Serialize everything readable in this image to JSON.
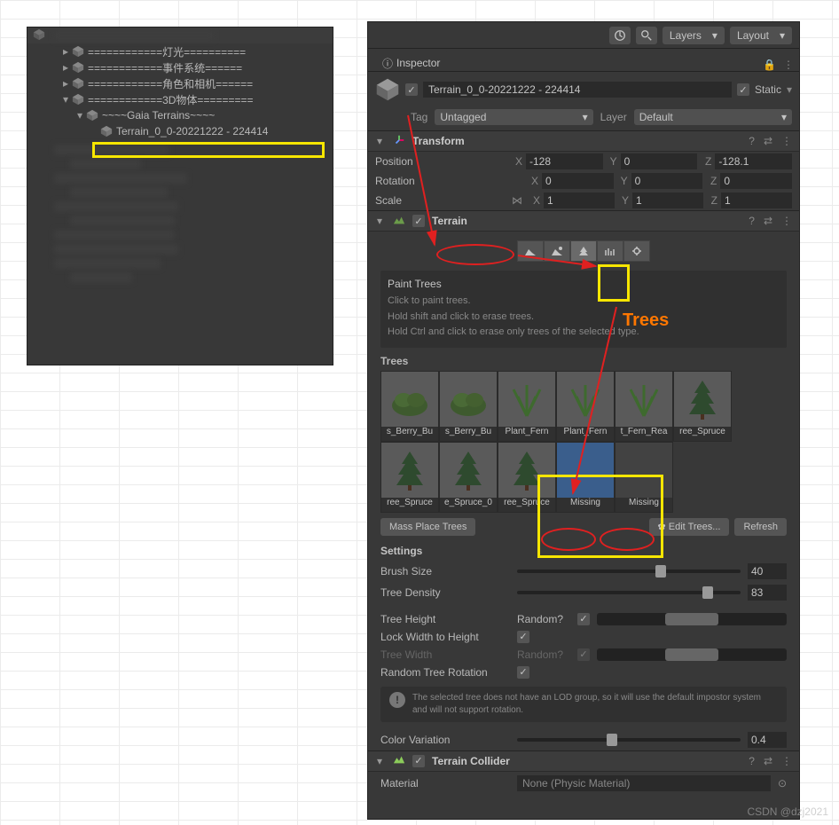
{
  "hierarchy": {
    "items": [
      {
        "indent": 0,
        "fold": "▸",
        "label": "============灯光=========="
      },
      {
        "indent": 0,
        "fold": "▸",
        "label": "============事件系统======"
      },
      {
        "indent": 0,
        "fold": "▸",
        "label": "============角色和相机======"
      },
      {
        "indent": 0,
        "fold": "▾",
        "label": "============3D物体========="
      },
      {
        "indent": 1,
        "fold": "▾",
        "label": "~~~~Gaia Terrains~~~~"
      },
      {
        "indent": 2,
        "fold": "",
        "label": "Terrain_0_0-20221222 - 224414",
        "selected": true
      }
    ]
  },
  "topbar": {
    "layers": "Layers",
    "layout": "Layout"
  },
  "inspector": {
    "tab_label": "Inspector",
    "object_name": "Terrain_0_0-20221222 - 224414",
    "static_label": "Static",
    "tag_label": "Tag",
    "tag_value": "Untagged",
    "layer_label": "Layer",
    "layer_value": "Default"
  },
  "transform": {
    "title": "Transform",
    "rows": {
      "position": {
        "label": "Position",
        "x": "-128",
        "y": "0",
        "z": "-128.1"
      },
      "rotation": {
        "label": "Rotation",
        "x": "0",
        "y": "0",
        "z": "0"
      },
      "scale": {
        "label": "Scale",
        "x": "1",
        "y": "1",
        "z": "1"
      }
    },
    "axes": {
      "x": "X",
      "y": "Y",
      "z": "Z"
    }
  },
  "terrain": {
    "title": "Terrain",
    "paint_title": "Paint Trees",
    "paint_hint": "Click to paint trees.",
    "hint_shift": "Hold shift and click to erase trees.",
    "hint_ctrl": "Hold Ctrl and click to erase only trees of the selected type.",
    "trees_label": "Trees",
    "tree_items": [
      {
        "cap": "s_Berry_Bu",
        "kind": "bush"
      },
      {
        "cap": "s_Berry_Bu",
        "kind": "bush"
      },
      {
        "cap": "Plant_Fern",
        "kind": "fern"
      },
      {
        "cap": "Plant_Fern",
        "kind": "fern"
      },
      {
        "cap": "t_Fern_Rea",
        "kind": "fern"
      },
      {
        "cap": "ree_Spruce",
        "kind": "tree"
      },
      {
        "cap": "ree_Spruce",
        "kind": "tree"
      },
      {
        "cap": "e_Spruce_0",
        "kind": "tree"
      },
      {
        "cap": "ree_Spruce",
        "kind": "tree"
      },
      {
        "cap": "Missing",
        "missing": true,
        "blue": true
      },
      {
        "cap": "Missing",
        "missing": true
      }
    ],
    "mass_place": "Mass Place Trees",
    "edit_trees": "✿ Edit Trees...",
    "refresh": "Refresh",
    "settings_label": "Settings",
    "brush_size": {
      "label": "Brush Size",
      "value": "40",
      "pct": 62
    },
    "tree_density": {
      "label": "Tree Density",
      "value": "83",
      "pct": 83
    },
    "tree_height": {
      "label": "Tree Height",
      "random_label": "Random?",
      "checked": true
    },
    "lock_width": {
      "label": "Lock Width to Height",
      "checked": true
    },
    "tree_width": {
      "label": "Tree Width",
      "random_label": "Random?",
      "checked": true
    },
    "random_rotation": {
      "label": "Random Tree Rotation",
      "checked": true
    },
    "lod_info": "The selected tree does not have an LOD group, so it will use the default impostor system and will not support rotation.",
    "color_variation": {
      "label": "Color Variation",
      "value": "0.4",
      "pct": 40
    }
  },
  "collider": {
    "title": "Terrain Collider",
    "material_label": "Material",
    "material_value": "None (Physic Material)"
  },
  "annotations": {
    "trees_text": "Trees"
  },
  "watermark": "CSDN @dzj2021"
}
